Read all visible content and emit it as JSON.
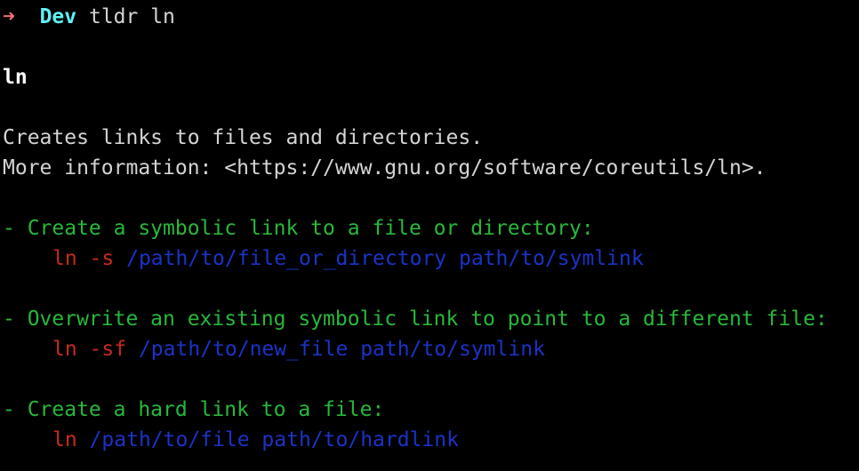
{
  "prompt": {
    "arrow": "➜",
    "directory": "Dev",
    "command": "tldr ln"
  },
  "page": {
    "title": "ln",
    "description": "Creates links to files and directories.",
    "more_info": "More information: <https://www.gnu.org/software/coreutils/ln>."
  },
  "examples": [
    {
      "description": "- Create a symbolic link to a file or directory:",
      "command": "ln -s",
      "args": "/path/to/file_or_directory path/to/symlink"
    },
    {
      "description": "- Overwrite an existing symbolic link to point to a different file:",
      "command": "ln -sf",
      "args": "/path/to/new_file path/to/symlink"
    },
    {
      "description": "- Create a hard link to a file:",
      "command": "ln",
      "args": "/path/to/file path/to/hardlink"
    }
  ],
  "colors": {
    "background": "#000000",
    "prompt_arrow": "#f07178",
    "prompt_dir": "#5ff2f6",
    "example_description": "#27b83a",
    "command": "#c82a1f",
    "argument": "#1a33c8"
  }
}
